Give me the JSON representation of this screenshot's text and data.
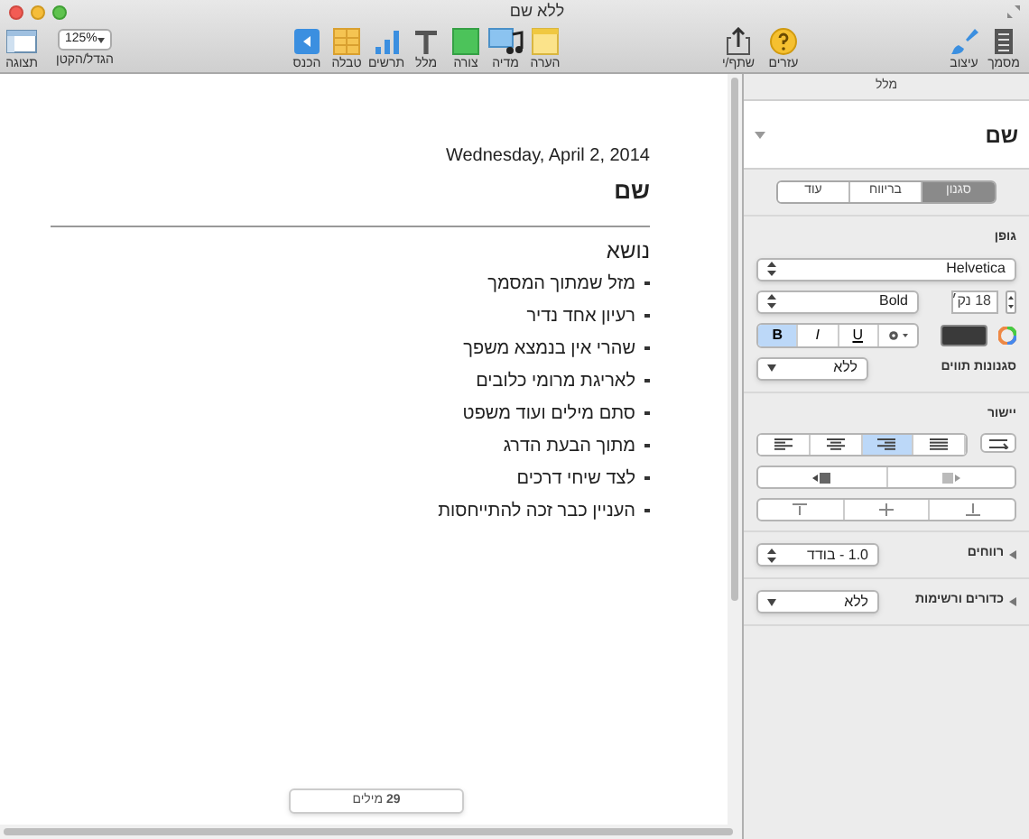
{
  "window": {
    "title": "ללא שם"
  },
  "toolbar": {
    "view": {
      "label": "תצוגה"
    },
    "zoom": {
      "value": "125%",
      "label": "הגדל/הקטן"
    },
    "insert_items": [
      {
        "kind": "comment",
        "label": "הערה"
      },
      {
        "kind": "media",
        "label": "מדיה"
      },
      {
        "kind": "shape",
        "label": "צורה"
      },
      {
        "kind": "text",
        "label": "מלל"
      },
      {
        "kind": "chart",
        "label": "תרשים"
      },
      {
        "kind": "table",
        "label": "טבלה"
      },
      {
        "kind": "insert",
        "label": "הכנס"
      }
    ],
    "share_items": [
      {
        "kind": "help",
        "label": "עזרים"
      },
      {
        "kind": "share",
        "label": "שתף/י"
      }
    ],
    "right_items": [
      {
        "kind": "document",
        "label": "מסמך"
      },
      {
        "kind": "format",
        "label": "עיצוב"
      }
    ]
  },
  "document": {
    "date": "Wednesday, April 2, 2014",
    "title": "שם",
    "heading": "נושא",
    "bullets": [
      "מזל שמתוך המסמך",
      "רעיון אחד נדיר",
      "שהרי אין בנמצא משפך",
      "לאריגת מרומי כלובים",
      "סתם מילים ועוד משפט",
      "מתוך הבעת הדרג",
      "לצד שיחי דרכים",
      "העניין כבר זכה להתייחסות"
    ],
    "word_count": "**29** מילים"
  },
  "inspector": {
    "header": "מלל",
    "style_name": "שם",
    "tabs": [
      {
        "label": "סגנון",
        "selected": true
      },
      {
        "label": "בריווח",
        "selected": false
      },
      {
        "label": "עוד",
        "selected": false
      }
    ],
    "font": {
      "label": "גופן",
      "family": "Helvetica",
      "typeface": "Bold",
      "size": "18 נק׳",
      "styles": [
        {
          "kind": "underline",
          "label": "U",
          "selected": false
        },
        {
          "kind": "italic",
          "label": "I",
          "selected": false
        },
        {
          "kind": "bold",
          "label": "B",
          "selected": true
        }
      ],
      "character_styles": {
        "label": "סגנונות תווים",
        "value": "ללא"
      }
    },
    "alignment": {
      "label": "יישור",
      "options": [
        {
          "kind": "left",
          "selected": false
        },
        {
          "kind": "center",
          "selected": false
        },
        {
          "kind": "right",
          "selected": true
        },
        {
          "kind": "justify",
          "selected": false
        }
      ]
    },
    "spacing": {
      "label": "רווחים",
      "value": "1.0 - בודד"
    },
    "bullets": {
      "label": "כדורים ורשימות",
      "value": "ללא"
    }
  }
}
